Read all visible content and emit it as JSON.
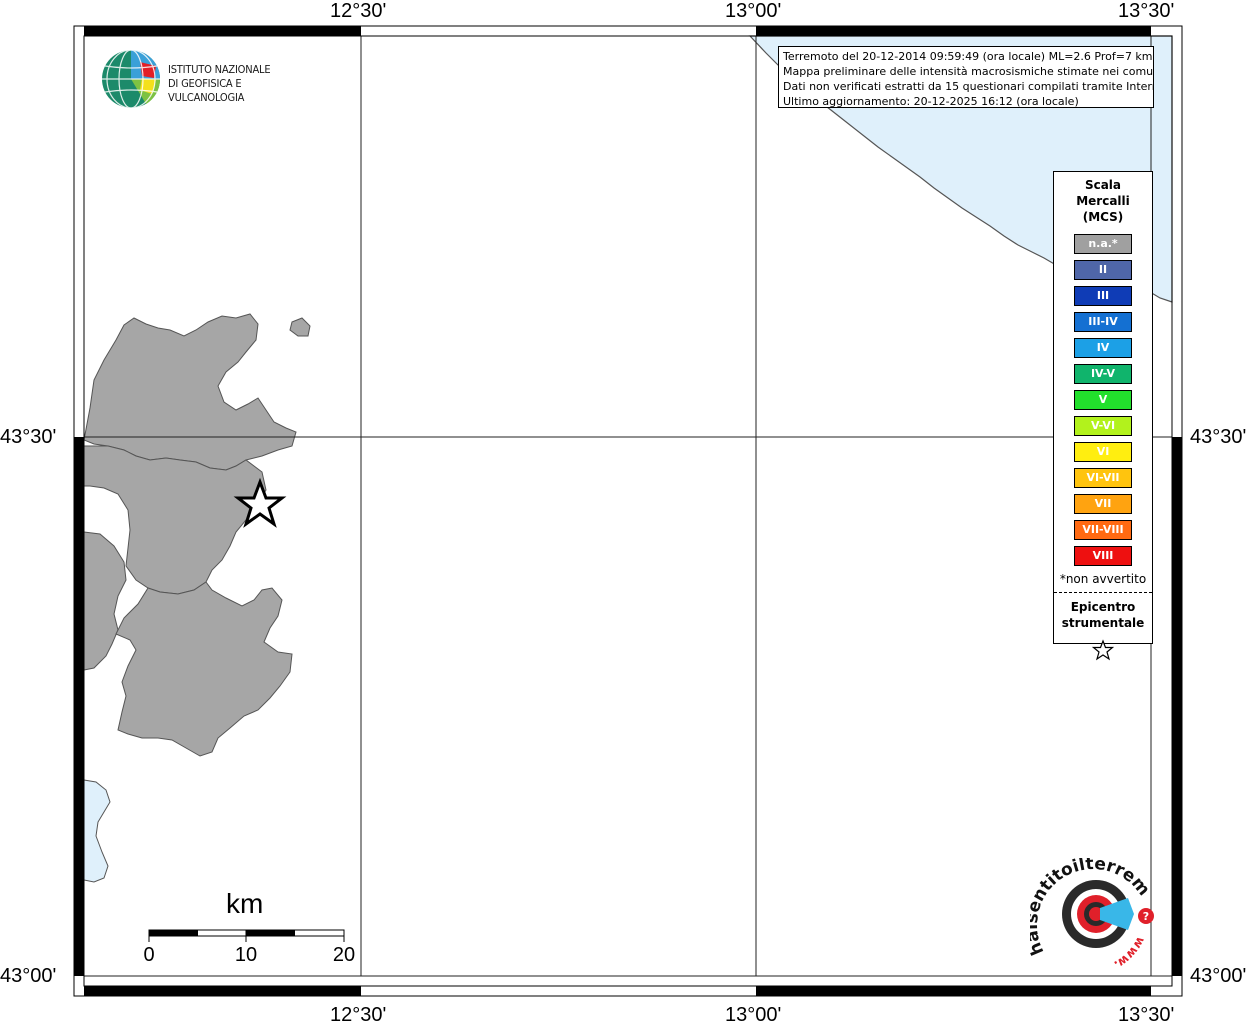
{
  "map": {
    "lon_labels": [
      "12°30'",
      "13°00'",
      "13°30'"
    ],
    "lat_labels": [
      "43°30'",
      "43°00'"
    ],
    "info_lines": [
      "Terremoto del 20-12-2014 09:59:49 (ora locale) ML=2.6 Prof=7 km",
      "Mappa preliminare delle intensità macrosismiche stimate nei comuni",
      "Dati non verificati estratti da 15 questionari compilati tramite Internet.",
      "Ultimo aggiornamento: 20-12-2025 16:12 (ora locale)"
    ],
    "sea_color": "#dff0fb",
    "land_color": "#a6a6a6"
  },
  "logo": {
    "line1": "ISTITUTO NAZIONALE",
    "line2": "DI GEOFISICA E VULCANOLOGIA"
  },
  "legend": {
    "title": [
      "Scala",
      "Mercalli",
      "(MCS)"
    ],
    "items": [
      {
        "label": "n.a.*",
        "color": "#a0a0a0"
      },
      {
        "label": "II",
        "color": "#4f66a8"
      },
      {
        "label": "III",
        "color": "#0f3cb6"
      },
      {
        "label": "III-IV",
        "color": "#1470d2"
      },
      {
        "label": "IV",
        "color": "#1ca0e6"
      },
      {
        "label": "IV-V",
        "color": "#10b46c"
      },
      {
        "label": "V",
        "color": "#22e02c"
      },
      {
        "label": "V-VI",
        "color": "#b2f21c"
      },
      {
        "label": "VI",
        "color": "#ffee10"
      },
      {
        "label": "VI-VII",
        "color": "#ffc40e"
      },
      {
        "label": "VII",
        "color": "#ffa310"
      },
      {
        "label": "VII-VIII",
        "color": "#ff6a12"
      },
      {
        "label": "VIII",
        "color": "#ee1010"
      }
    ],
    "note": "*non avvertito",
    "epicenter": [
      "Epicentro",
      "strumentale"
    ]
  },
  "scalebar": {
    "unit": "km",
    "ticks": [
      "0",
      "10",
      "20"
    ]
  },
  "watermark": {
    "brand": "haisentitoilterremoto.it",
    "www": "www."
  }
}
